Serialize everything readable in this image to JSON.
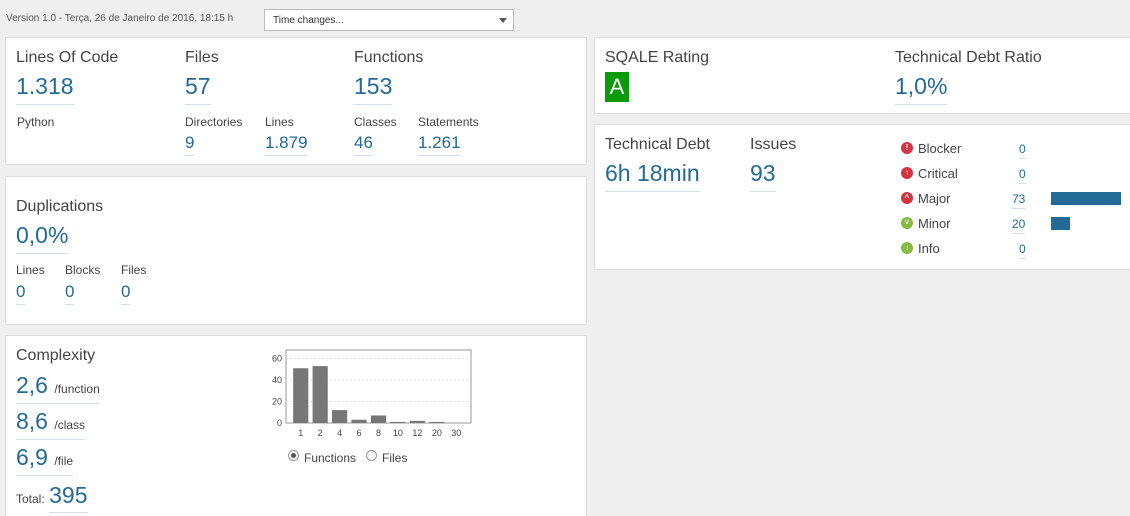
{
  "header": {
    "version": "Version 1.0 - Terça, 26 de Janeiro de 2016, 18:15 h",
    "time_changes": "Time changes..."
  },
  "size": {
    "lines_of_code_label": "Lines Of Code",
    "lines_of_code": "1.318",
    "language": "Python",
    "files_label": "Files",
    "files": "57",
    "directories_label": "Directories",
    "directories": "9",
    "lines_label": "Lines",
    "lines": "1.879",
    "functions_label": "Functions",
    "functions": "153",
    "classes_label": "Classes",
    "classes": "46",
    "statements_label": "Statements",
    "statements": "1.261"
  },
  "duplications": {
    "title": "Duplications",
    "density": "0,0%",
    "lines_label": "Lines",
    "lines": "0",
    "blocks_label": "Blocks",
    "blocks": "0",
    "files_label": "Files",
    "files": "0"
  },
  "complexity": {
    "title": "Complexity",
    "per_function": "2,6",
    "per_function_unit": "/function",
    "per_class": "8,6",
    "per_class_unit": "/class",
    "per_file": "6,9",
    "per_file_unit": "/file",
    "total_label": "Total:",
    "total": "395",
    "radio_functions": "Functions",
    "radio_files": "Files",
    "selected": "Functions"
  },
  "chart_data": {
    "type": "bar",
    "categories": [
      "1",
      "2",
      "4",
      "6",
      "8",
      "10",
      "12",
      "20",
      "30"
    ],
    "values": [
      51,
      53,
      12,
      3,
      7,
      1,
      2,
      1,
      0
    ],
    "yticks": [
      "60",
      "40",
      "20",
      "0"
    ],
    "ylim": [
      0,
      68
    ],
    "bar_color": "#777777",
    "grid": true
  },
  "sqale": {
    "rating_label": "SQALE Rating",
    "rating": "A",
    "rating_color": "#0a9a0a",
    "debt_ratio_label": "Technical Debt Ratio",
    "debt_ratio": "1,0%"
  },
  "issues": {
    "debt_label": "Technical Debt",
    "debt": "6h 18min",
    "issues_label": "Issues",
    "issues": "93",
    "severities": [
      {
        "label": "Blocker",
        "count": "0",
        "value": 0,
        "icon": "blocker-icon",
        "color": "#d4333f"
      },
      {
        "label": "Critical",
        "count": "0",
        "value": 0,
        "icon": "critical-icon",
        "color": "#d4333f"
      },
      {
        "label": "Major",
        "count": "73",
        "value": 73,
        "icon": "major-icon",
        "color": "#d4333f"
      },
      {
        "label": "Minor",
        "count": "20",
        "value": 20,
        "icon": "minor-icon",
        "color": "#85bb43"
      },
      {
        "label": "Info",
        "count": "0",
        "value": 0,
        "icon": "info-icon",
        "color": "#85bb43"
      }
    ],
    "bar_color": "#236a97"
  }
}
